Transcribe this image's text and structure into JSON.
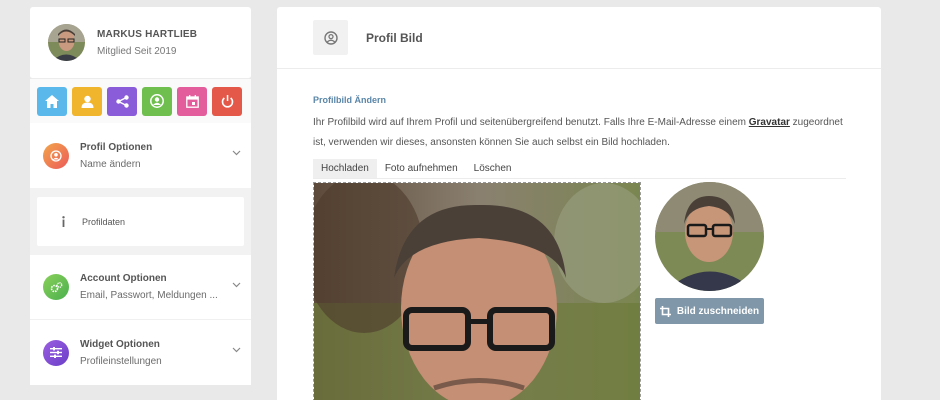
{
  "user": {
    "name": "MARKUS HARTLIEB",
    "member_since": "Mitglied Seit 2019"
  },
  "quick_buttons": [
    {
      "icon": "home-icon",
      "color": "#5ab8ea"
    },
    {
      "icon": "user-icon",
      "color": "#f0b52c"
    },
    {
      "icon": "share-icon",
      "color": "#8a5cd9"
    },
    {
      "icon": "user-circle-icon",
      "color": "#6fbf4e"
    },
    {
      "icon": "calendar-icon",
      "color": "#e35d9c"
    },
    {
      "icon": "power-icon",
      "color": "#e4584a"
    }
  ],
  "menu": {
    "profile_options": {
      "title": "Profil Optionen",
      "subtitle": "Name ändern"
    },
    "profile_data": {
      "label": "Profildaten"
    },
    "account_options": {
      "title": "Account Optionen",
      "subtitle": "Email, Passwort, Meldungen ..."
    },
    "widget_options": {
      "title": "Widget Optionen",
      "subtitle": "Profileinstellungen"
    }
  },
  "main": {
    "title": "Profil Bild",
    "section_label": "Profilbild Ändern",
    "description_before": "Ihr Profilbild wird auf Ihrem Profil und seitenübergreifend benutzt. Falls Ihre E-Mail-Adresse einem ",
    "description_link": "Gravatar",
    "description_after": " zugeordnet ist, verwenden wir dieses, ansonsten können Sie auch selbst ein Bild hochladen.",
    "tabs": [
      "Hochladen",
      "Foto aufnehmen",
      "Löschen"
    ],
    "crop_button": "Bild zuschneiden"
  }
}
